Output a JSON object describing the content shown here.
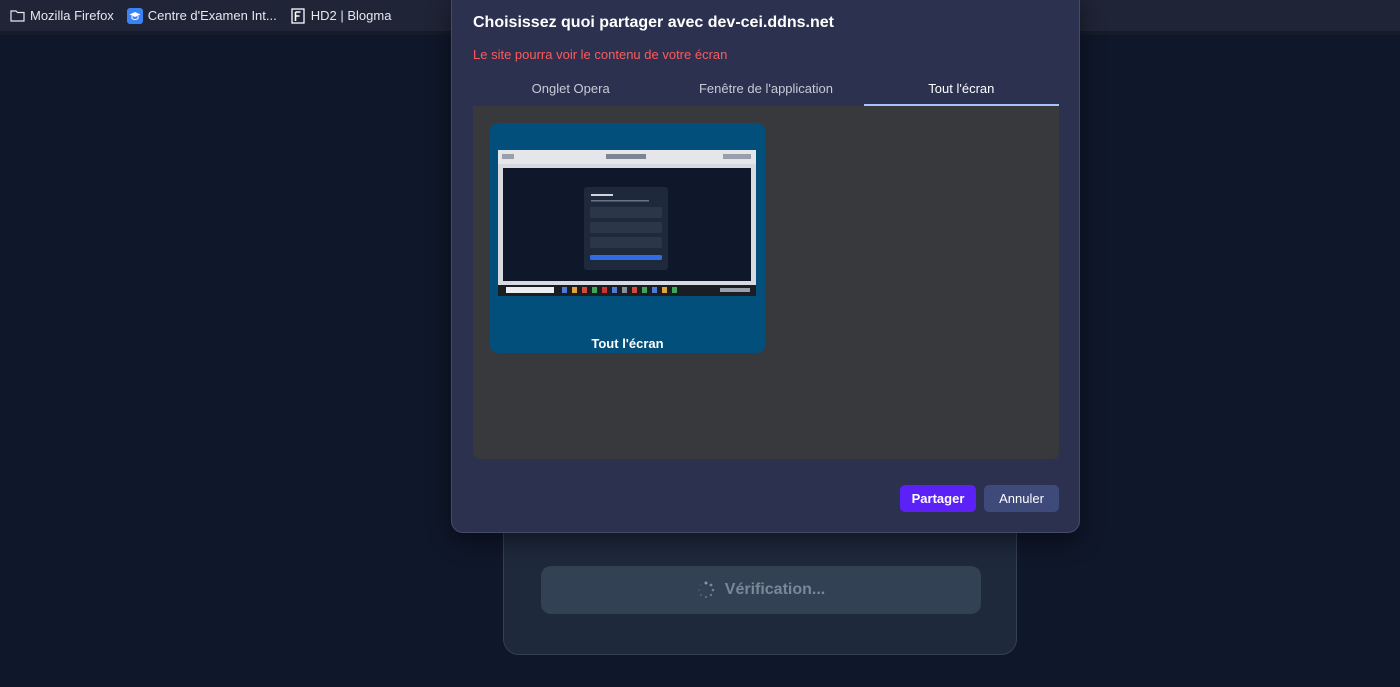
{
  "bookmarks": [
    {
      "label": "Mozilla Firefox",
      "icon": "folder-icon"
    },
    {
      "label": "Centre d'Examen Int...",
      "icon": "graduation-cap-icon"
    },
    {
      "label": "HD2 | Blogma",
      "icon": "letter-f-icon"
    }
  ],
  "dialog": {
    "title": "Choisissez quoi partager avec dev-cei.ddns.net",
    "subtitle": "Le site pourra voir le contenu de votre écran",
    "tabs": [
      {
        "label": "Onglet Opera",
        "active": false
      },
      {
        "label": "Fenêtre de l'application",
        "active": false
      },
      {
        "label": "Tout l'écran",
        "active": true
      }
    ],
    "screen_option_label": "Tout l'écran",
    "share_label": "Partager",
    "cancel_label": "Annuler"
  },
  "background": {
    "verify_label": "Vérification..."
  },
  "colors": {
    "page_bg": "#0f172a",
    "dialog_bg": "#2c3150",
    "subtitle": "#ff5a5a",
    "share_button": "#5b21f6",
    "cancel_button": "#3d4a7a",
    "active_tab_underline": "#a8c4ff",
    "screen_card": "#024f7c"
  }
}
